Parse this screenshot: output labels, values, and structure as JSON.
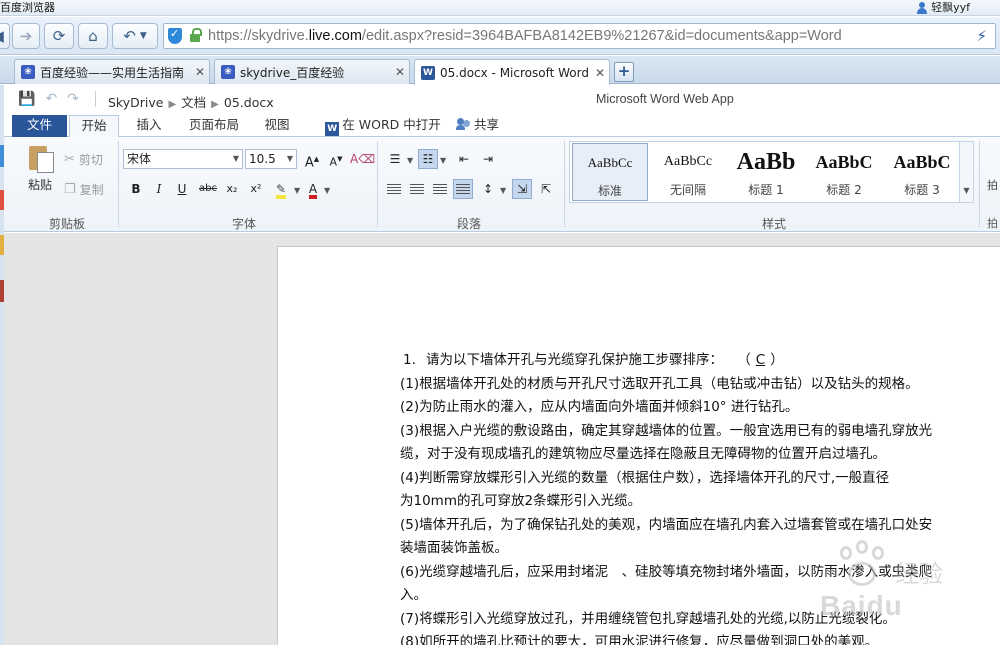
{
  "browser": {
    "app_title": "百度浏览器",
    "user_name": "轻飘yyf",
    "url_prefix": "https://skydrive.",
    "url_host": "live.com",
    "url_rest": "/edit.aspx?resid=3964BAFBA8142EB9%21267&id=documents&app=Word"
  },
  "tabs": [
    {
      "label": "百度经验——实用生活指南",
      "icon": "baidu-paw-icon"
    },
    {
      "label": "skydrive_百度经验",
      "icon": "baidu-paw-icon"
    },
    {
      "label": "05.docx - Microsoft Word Web App",
      "icon": "word-icon",
      "active": true
    }
  ],
  "app": {
    "breadcrumb": [
      "SkyDrive",
      "文档",
      "05.docx"
    ],
    "name": "Microsoft Word Web App"
  },
  "ribbon_tabs": {
    "file": "文件",
    "home": "开始",
    "insert": "插入",
    "layout": "页面布局",
    "view": "视图",
    "open_in_word": "在 WORD 中打开",
    "share": "共享"
  },
  "clipboard": {
    "paste": "粘贴",
    "cut": "剪切",
    "copy": "复制",
    "label": "剪贴板"
  },
  "font": {
    "name": "宋体",
    "size": "10.5",
    "label": "字体",
    "bold": "B",
    "italic": "I",
    "underline": "U",
    "strike": "abc",
    "subscript": "x₂",
    "superscript": "x²"
  },
  "paragraph": {
    "label": "段落"
  },
  "styles": {
    "label": "样式",
    "items": [
      {
        "sample": "AaBbCc",
        "name": "标准"
      },
      {
        "sample": "AaBbCc",
        "name": "无间隔"
      },
      {
        "sample": "AaBb",
        "name": "标题 1"
      },
      {
        "sample": "AaBbC",
        "name": "标题 2"
      },
      {
        "sample": "AaBbC",
        "name": "标题 3"
      }
    ]
  },
  "document": {
    "question_num": "1.",
    "question": "请为以下墙体开孔与光缆穿孔保护施工步骤排序：",
    "answer_open": "（",
    "answer": "C",
    "answer_close": "）",
    "lines": [
      "(1)根据墙体开孔处的材质与开孔尺寸选取开孔工具（电钻或冲击钻）以及钻头的规格。",
      "(2)为防止雨水的灌入，应从内墙面向外墙面并倾斜10° 进行钻孔。",
      "(3)根据入户光缆的敷设路由，确定其穿越墙体的位置。一般宜选用已有的弱电墙孔穿放光",
      "缆，对于没有现成墙孔的建筑物应尽量选择在隐蔽且无障碍物的位置开启过墙孔。",
      "(4)判断需穿放蝶形引入光缆的数量（根据住户数），选择墙体开孔的尺寸,一般直径",
      "为10mm的孔可穿放2条蝶形引入光缆。",
      "(5)墙体开孔后，为了确保钻孔处的美观，内墙面应在墙孔内套入过墙套管或在墙孔口处安",
      "装墙面装饰盖板。",
      "(6)光缆穿越墙孔后，应采用封堵泥　、硅胶等填充物封堵外墙面，以防雨水渗入或虫类爬",
      "入。",
      "(7)将蝶形引入光缆穿放过孔，并用缠绕管包扎穿越墙孔处的光缆,以防止光缆裂化。",
      "(8)如所开的墙孔比预计的要大，可用水泥进行修复，应尽量做到洞口处的美观。"
    ]
  },
  "watermark": {
    "text": "Baidu",
    "sub": "经验"
  }
}
